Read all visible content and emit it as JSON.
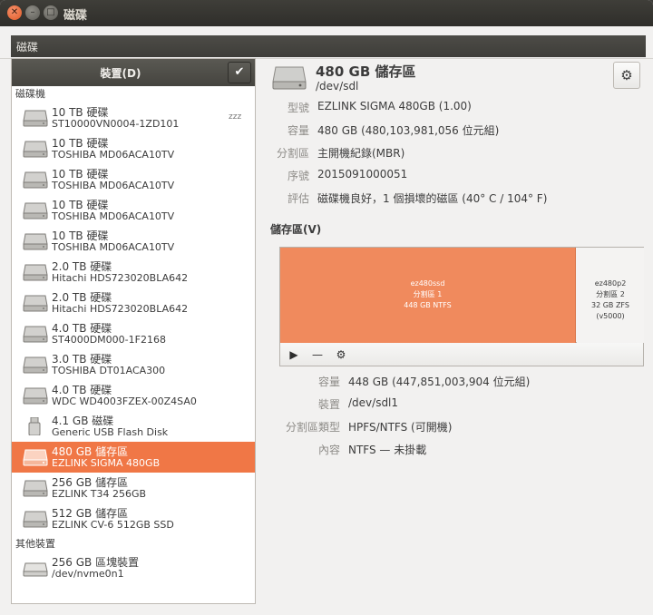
{
  "window": {
    "title": "磁碟"
  },
  "toolbar": {
    "title": "磁碟"
  },
  "sidebar": {
    "header_label": "裝置(D)",
    "check_glyph": "✔",
    "section_disks": "磁碟機",
    "section_other": "其他裝置",
    "sleep_glyph": "zzz",
    "drives": [
      {
        "line1": "10 TB 硬碟",
        "line2": "ST10000VN0004-1ZD101",
        "icon": "hard-disk-icon"
      },
      {
        "line1": "10 TB 硬碟",
        "line2": "TOSHIBA MD06ACA10TV",
        "icon": "hard-disk-icon"
      },
      {
        "line1": "10 TB 硬碟",
        "line2": "TOSHIBA MD06ACA10TV",
        "icon": "hard-disk-icon"
      },
      {
        "line1": "10 TB 硬碟",
        "line2": "TOSHIBA MD06ACA10TV",
        "icon": "hard-disk-icon"
      },
      {
        "line1": "10 TB 硬碟",
        "line2": "TOSHIBA MD06ACA10TV",
        "icon": "hard-disk-icon"
      },
      {
        "line1": "2.0 TB 硬碟",
        "line2": "Hitachi HDS723020BLA642",
        "icon": "hard-disk-icon"
      },
      {
        "line1": "2.0 TB 硬碟",
        "line2": "Hitachi HDS723020BLA642",
        "icon": "hard-disk-icon"
      },
      {
        "line1": "4.0 TB 硬碟",
        "line2": "ST4000DM000-1F2168",
        "icon": "hard-disk-icon"
      },
      {
        "line1": "3.0 TB 硬碟",
        "line2": "TOSHIBA DT01ACA300",
        "icon": "hard-disk-icon"
      },
      {
        "line1": "4.0 TB 硬碟",
        "line2": "WDC WD4003FZEX-00Z4SA0",
        "icon": "hard-disk-icon"
      },
      {
        "line1": "4.1 GB 磁碟",
        "line2": "Generic USB Flash Disk",
        "icon": "usb-drive-icon"
      },
      {
        "line1": "480 GB 儲存區",
        "line2": "EZLINK SIGMA 480GB",
        "icon": "hard-disk-icon",
        "selected": true
      },
      {
        "line1": "256 GB 儲存區",
        "line2": "EZLINK T34 256GB",
        "icon": "hard-disk-icon"
      },
      {
        "line1": "512 GB 儲存區",
        "line2": "EZLINK CV-6 512GB SSD",
        "icon": "hard-disk-icon"
      }
    ],
    "other": [
      {
        "line1": "256 GB 區塊裝置",
        "line2": "/dev/nvme0n1",
        "icon": "block-device-icon"
      }
    ]
  },
  "detail": {
    "title": "480 GB 儲存區",
    "subtitle": "/dev/sdl",
    "gear_glyph": "⚙",
    "fields": [
      {
        "key": "型號",
        "value": "EZLINK SIGMA 480GB (1.00)"
      },
      {
        "key": "容量",
        "value": "480 GB (480,103,981,056 位元組)"
      },
      {
        "key": "分割區",
        "value": "主開機紀錄(MBR)"
      },
      {
        "key": "序號",
        "value": "2015091000051"
      },
      {
        "key": "評估",
        "value": "磁碟機良好，1 個損壞的磁區 (40° C / 104° F)"
      }
    ],
    "volumes_label": "儲存區(V)",
    "partitions": [
      {
        "name": "ez480ssd",
        "label": "分割區 1",
        "desc": "448 GB NTFS",
        "fraction": 0.933
      },
      {
        "name": "ez480p2",
        "label": "分割區 2",
        "desc": "32 GB ZFS (v5000)",
        "fraction": 0.067
      }
    ],
    "tools": {
      "play": "▶",
      "minus": "—",
      "gear": "⚙"
    },
    "volume_fields": [
      {
        "key": "容量",
        "value": "448 GB (447,851,003,904 位元組)"
      },
      {
        "key": "裝置",
        "value": "/dev/sdl1"
      },
      {
        "key": "分割區類型",
        "value": "HPFS/NTFS (可開機)"
      },
      {
        "key": "內容",
        "value": "NTFS — 未掛載"
      }
    ]
  },
  "colors": {
    "accent": "#f07746",
    "partition_fill": "#f08a5d",
    "header_dark": "#45443f"
  }
}
